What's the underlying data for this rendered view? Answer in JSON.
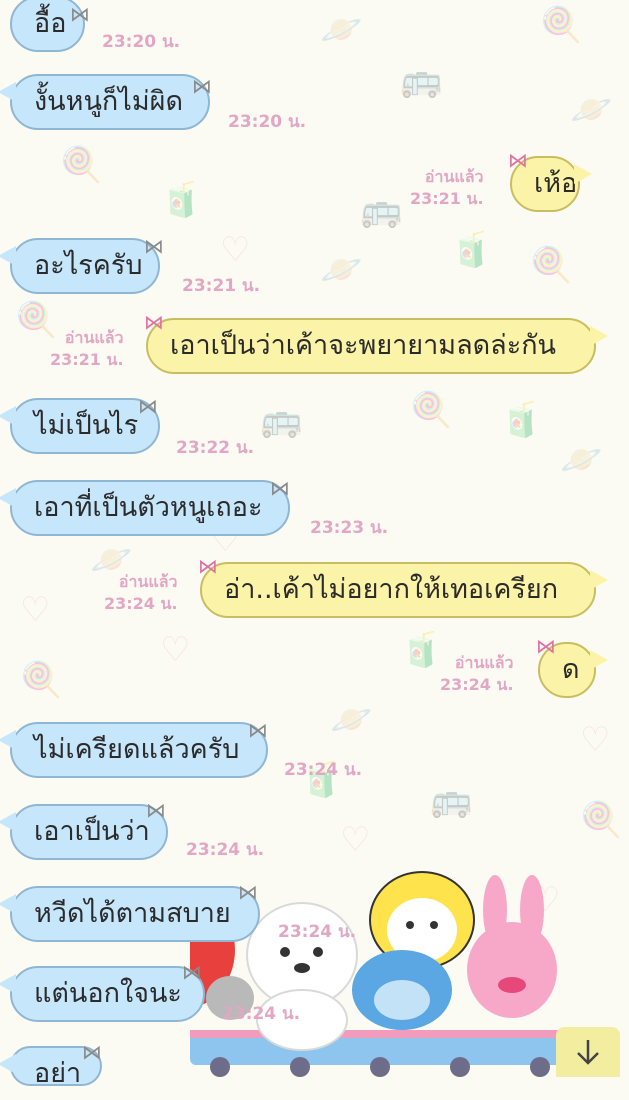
{
  "messages": [
    {
      "side": "in",
      "text": "อื้อ",
      "time": "23:20 น."
    },
    {
      "side": "in",
      "text": "งั้นหนูก็ไม่ผิด",
      "time": "23:20 น."
    },
    {
      "side": "out",
      "text": "เห้อ",
      "read": "อ่านแล้ว",
      "time": "23:21 น."
    },
    {
      "side": "in",
      "text": "อะไรครับ",
      "time": "23:21 น."
    },
    {
      "side": "out",
      "text": "เอาเป็นว่าเค้าจะพยายามลดล่ะกัน",
      "read": "อ่านแล้ว",
      "time": "23:21 น."
    },
    {
      "side": "in",
      "text": "ไม่เป็นไร",
      "time": "23:22 น."
    },
    {
      "side": "in",
      "text": "เอาที่เป็นตัวหนูเถอะ",
      "time": "23:23 น."
    },
    {
      "side": "out",
      "text": "อ่า..เค้าไม่อยากให้เทอเครียก",
      "read": "อ่านแล้ว",
      "time": "23:24 น."
    },
    {
      "side": "out",
      "text": "ด",
      "read": "อ่านแล้ว",
      "time": "23:24 น."
    },
    {
      "side": "in",
      "text": "ไม่เครียดแล้วครับ",
      "time": "23:24 น."
    },
    {
      "side": "in",
      "text": "เอาเป็นว่า",
      "time": "23:24 น."
    },
    {
      "side": "in",
      "text": "หวีดได้ตามสบาย",
      "time": "23:24 น."
    },
    {
      "side": "in",
      "text": "แต่นอกใจนะ",
      "time": "23:24 น."
    },
    {
      "side": "in",
      "text": "อย่า",
      "time": ""
    }
  ],
  "icons": {
    "bow_in": "ribbon-bow-icon",
    "bow_out": "pink-bow-icon",
    "scroll": "arrow-down-icon"
  },
  "colors": {
    "incoming_bubble": "#c6e6fb",
    "outgoing_bubble": "#fbf3a7",
    "timestamp": "#e2a7c4",
    "scroll_button": "#f3ee9f"
  }
}
